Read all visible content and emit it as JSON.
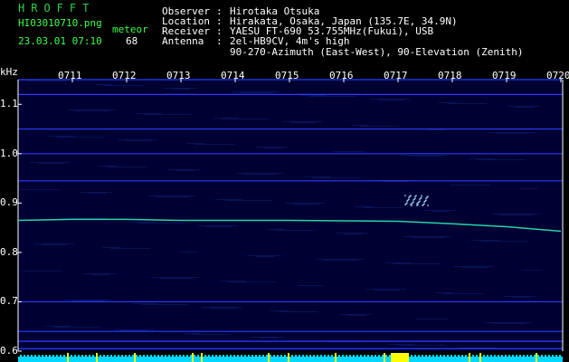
{
  "header": {
    "logo": "HROFFT",
    "filename": "HI03010710.png",
    "datetime": "23.03.01 07:10",
    "meteor_label": "meteor",
    "meteor_count": "68",
    "observer_label": "Observer",
    "observer_value": "Hirotaka Otsuka",
    "location_label": "Location",
    "location_value": "Hirakata, Osaka, Japan (135.7E, 34.9N)",
    "receiver_label": "Receiver",
    "receiver_value": "YAESU FT-690 53.755MHz(Fukui), USB",
    "antenna_label": "Antenna",
    "antenna_value": "2el-HB9CV, 4m's high",
    "antenna_value2": "90-270-Azimuth (East-West), 90-Elevation (Zenith)",
    "separator": ":"
  },
  "chart_data": {
    "type": "spectrogram",
    "y_unit": "kHz",
    "x_ticks": [
      "0711",
      "0712",
      "0713",
      "0714",
      "0715",
      "0716",
      "0717",
      "0718",
      "0719",
      "0720"
    ],
    "y_ticks": [
      "1.1",
      "1.0",
      "0.9",
      "0.8",
      "0.7",
      "0.6"
    ],
    "y_range": [
      0.6,
      1.15
    ],
    "carrier_trace": [
      {
        "t": "0710",
        "khz": 0.865
      },
      {
        "t": "0711",
        "khz": 0.867
      },
      {
        "t": "0712",
        "khz": 0.867
      },
      {
        "t": "0713",
        "khz": 0.865
      },
      {
        "t": "0714",
        "khz": 0.865
      },
      {
        "t": "0715",
        "khz": 0.865
      },
      {
        "t": "0716",
        "khz": 0.864
      },
      {
        "t": "0717",
        "khz": 0.863
      },
      {
        "t": "0718",
        "khz": 0.858
      },
      {
        "t": "0719",
        "khz": 0.852
      },
      {
        "t": "0720",
        "khz": 0.843
      }
    ],
    "horizontal_lines_khz": [
      1.15,
      1.12,
      1.05,
      1.0,
      0.945,
      0.7,
      0.64,
      0.62,
      0.605
    ],
    "meteor_echo": {
      "t": "0717",
      "khz": 0.905
    },
    "colors": {
      "background": "#000033",
      "line": "#2b3cff",
      "carrier": "#27d3a8",
      "echo": "#9fe6ff",
      "bar": "#00d8ff",
      "bar_hot": "#ffff00"
    }
  }
}
